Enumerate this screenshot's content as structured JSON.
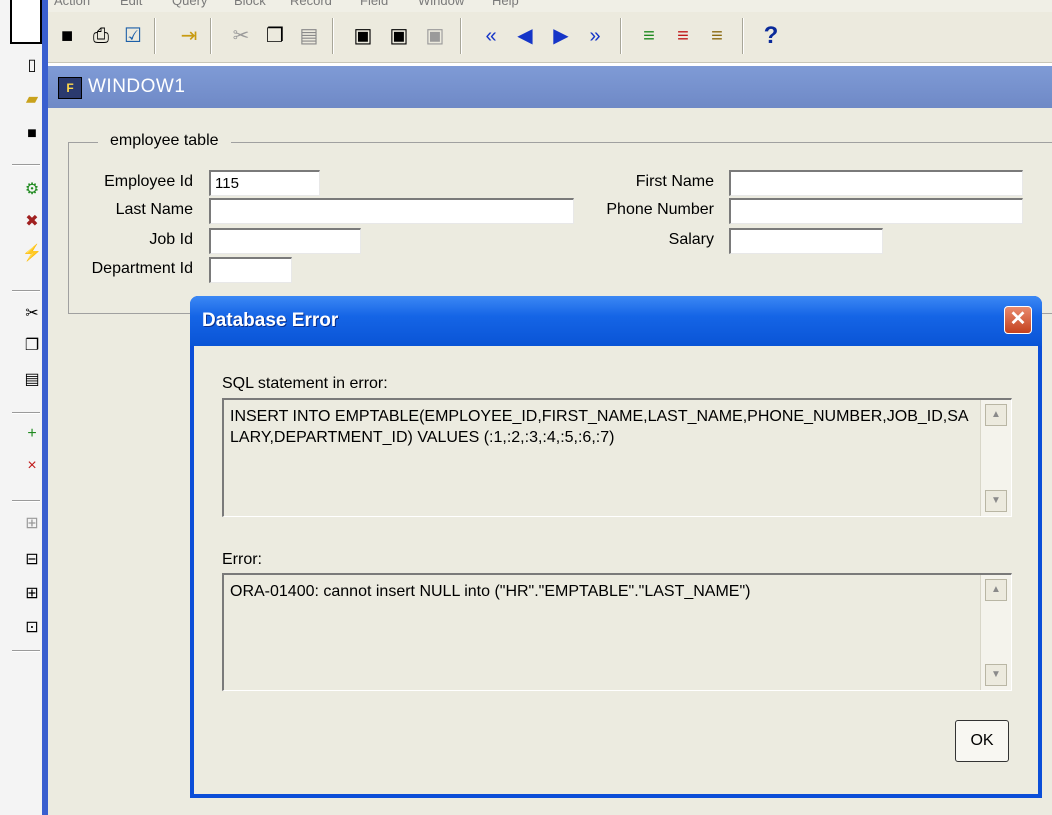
{
  "menu": [
    "Action",
    "Edit",
    "Query",
    "Block",
    "Record",
    "Field",
    "Window",
    "Help"
  ],
  "toolbar": {
    "help_glyph": "?"
  },
  "window": {
    "title": "WINDOW1"
  },
  "form": {
    "group_title": "employee table",
    "employee_id_label": "Employee Id",
    "employee_id_value": "115",
    "last_name_label": "Last Name",
    "job_id_label": "Job Id",
    "department_id_label": "Department Id",
    "first_name_label": "First Name",
    "phone_number_label": "Phone Number",
    "salary_label": "Salary"
  },
  "dialog": {
    "title": "Database Error",
    "close_glyph": "✕",
    "sql_label": "SQL statement in error:",
    "sql_text": "INSERT INTO EMPTABLE(EMPLOYEE_ID,FIRST_NAME,LAST_NAME,PHONE_NUMBER,JOB_ID,SALARY,DEPARTMENT_ID) VALUES (:1,:2,:3,:4,:5,:6,:7)",
    "error_label": "Error:",
    "error_text": "ORA-01400: cannot insert NULL into (\"HR\".\"EMPTABLE\".\"LAST_NAME\")",
    "ok_label": "OK"
  }
}
